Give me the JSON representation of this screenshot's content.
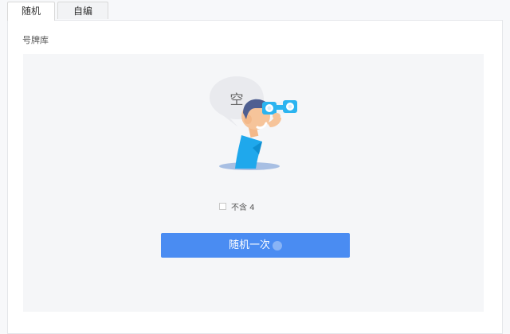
{
  "tabs": [
    {
      "label": "随机",
      "active": true
    },
    {
      "label": "自编",
      "active": false
    }
  ],
  "section": {
    "label": "号牌库"
  },
  "empty_state": {
    "bubble_text": "空"
  },
  "option": {
    "label": "不含 4",
    "checked": false
  },
  "action": {
    "label": "随机一次"
  },
  "colors": {
    "accent": "#4a8cf2",
    "panel_bg": "#ffffff",
    "stage_bg": "#f5f6f8",
    "binocular": "#2bb4f0",
    "shirt": "#1fa8ec",
    "hair": "#4f5f91",
    "skin": "#f6c49a"
  }
}
